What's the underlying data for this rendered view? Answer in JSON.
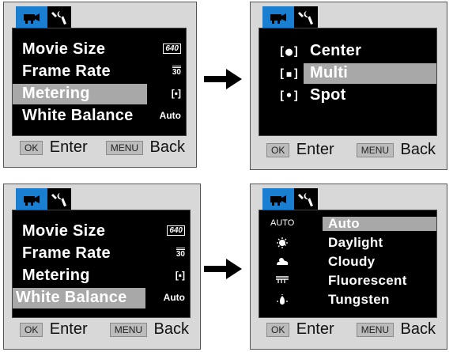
{
  "panels": {
    "top_left": {
      "items": [
        {
          "label": "Movie Size",
          "value_icon": "640"
        },
        {
          "label": "Frame Rate",
          "value_icon": "30"
        },
        {
          "label": "Metering",
          "value_icon": "[▪]",
          "selected": true
        },
        {
          "label": "White Balance",
          "value": "Auto"
        }
      ],
      "footer": {
        "ok_key": "OK",
        "enter": "Enter",
        "menu_key": "MENU",
        "back": "Back"
      }
    },
    "top_right": {
      "items": [
        {
          "icon": "[●]",
          "label": "Center"
        },
        {
          "icon": "[▪]",
          "label": "Multi",
          "selected": true
        },
        {
          "icon": "[•]",
          "label": "Spot"
        }
      ],
      "footer": {
        "ok_key": "OK",
        "enter": "Enter",
        "menu_key": "MENU",
        "back": "Back"
      }
    },
    "bottom_left": {
      "items": [
        {
          "label": "Movie Size",
          "value_icon": "640"
        },
        {
          "label": "Frame Rate",
          "value_icon": "30"
        },
        {
          "label": "Metering",
          "value_icon": "[▪]"
        },
        {
          "label": "White Balance",
          "value": "Auto",
          "selected": true
        }
      ],
      "footer": {
        "ok_key": "OK",
        "enter": "Enter",
        "menu_key": "MENU",
        "back": "Back"
      }
    },
    "bottom_right": {
      "items": [
        {
          "icon": "AUTO",
          "label": "Auto",
          "selected": true
        },
        {
          "icon": "sun-icon",
          "label": "Daylight"
        },
        {
          "icon": "cloud-icon",
          "label": "Cloudy"
        },
        {
          "icon": "fluorescent-icon",
          "label": "Fluorescent"
        },
        {
          "icon": "bulb-icon",
          "label": "Tungsten"
        }
      ],
      "footer": {
        "ok_key": "OK",
        "enter": "Enter",
        "menu_key": "MENU",
        "back": "Back"
      }
    }
  },
  "colors": {
    "accent_tab": "#1a7fd0",
    "highlight": "#a8a8a8",
    "screen": "#000000"
  }
}
